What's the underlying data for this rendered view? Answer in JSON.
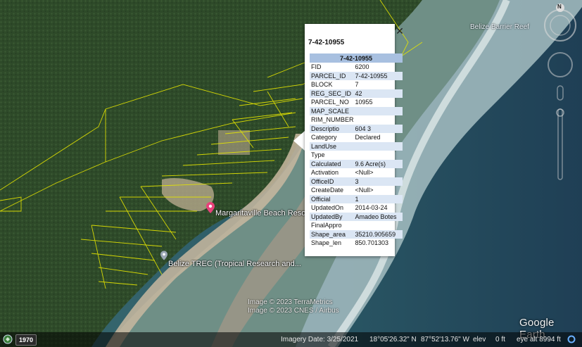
{
  "popup": {
    "title": "7-42-10955",
    "table_header": "7-42-10955",
    "rows": [
      {
        "key": "FID",
        "value": "6200"
      },
      {
        "key": "PARCEL_ID",
        "value": "7-42-10955"
      },
      {
        "key": "BLOCK",
        "value": "7"
      },
      {
        "key": "REG_SEC_ID",
        "value": "42"
      },
      {
        "key": "PARCEL_NO",
        "value": "10955"
      },
      {
        "key": "MAP_SCALE",
        "value": ""
      },
      {
        "key": "RIM_NUMBER",
        "value": ""
      },
      {
        "key": "Descriptio",
        "value": "604 3"
      },
      {
        "key": "Category",
        "value": "Declared"
      },
      {
        "key": "LandUse",
        "value": ""
      },
      {
        "key": "Type",
        "value": ""
      },
      {
        "key": "Calculated",
        "value": "9.6 Acre(s)"
      },
      {
        "key": "Activation",
        "value": "<Null>"
      },
      {
        "key": "OfficeID",
        "value": "3"
      },
      {
        "key": "CreateDate",
        "value": "<Null>"
      },
      {
        "key": "Official",
        "value": "1"
      },
      {
        "key": "UpdatedOn",
        "value": "2014-03-24"
      },
      {
        "key": "UpdatedBy",
        "value": "Amadeo Botes"
      },
      {
        "key": "FinalAppro",
        "value": ""
      },
      {
        "key": "Shape_area",
        "value": "35210.905659"
      },
      {
        "key": "Shape_len",
        "value": "850.701303"
      }
    ],
    "close_symbol": "✕"
  },
  "places": {
    "margaritaville": "Margaritaville Beach Resort",
    "trec": "Belize TREC (Tropical Research and...",
    "reef": "Belize Barrier Reef"
  },
  "credits": {
    "line1": "Image © 2023 TerraMetrics",
    "line2": "Image © 2023 CNES / Airbus"
  },
  "logo": "Google Earth",
  "compass_letter": "N",
  "status": {
    "year": "1970",
    "imagery_date": "Imagery Date: 3/25/2021",
    "lat": "18°05'26.32\" N",
    "lon": "87°52'13.76\" W",
    "elev_label": "elev",
    "elev_value": "0 ft",
    "eye_alt": "eye alt  8994 ft"
  },
  "colors": {
    "parcel_lines": "#e6e600",
    "popup_header": "#a8c0e0",
    "popup_alt_row": "#dbe6f4",
    "pin_pink": "#e8417a",
    "pin_gray": "#9aa6b2"
  }
}
